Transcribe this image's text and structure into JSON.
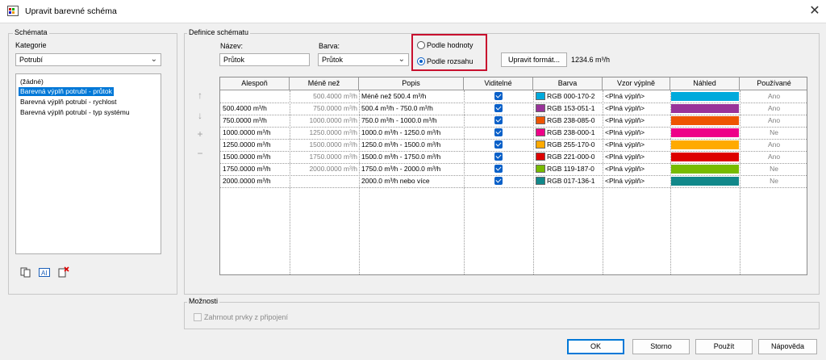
{
  "window": {
    "title": "Upravit barevné schéma",
    "close_glyph": "✕"
  },
  "schemes": {
    "legend": "Schémata",
    "category_label": "Kategorie",
    "category_value": "Potrubí",
    "list": [
      "(žádné)",
      "Barevná výplň potrubí - průtok",
      "Barevná výplň potrubí - rychlost",
      "Barevná výplň potrubí - typ systému"
    ],
    "selected_index": 1
  },
  "definition": {
    "legend": "Definice schématu",
    "name_label": "Název:",
    "name_value": "Průtok",
    "color_label": "Barva:",
    "color_value": "Průtok",
    "radio_by_value": "Podle hodnoty",
    "radio_by_range": "Podle rozsahu",
    "selected_radio": "range",
    "edit_format_button": "Upravit formát...",
    "format_sample": "1234.6 m³/h"
  },
  "table": {
    "columns": [
      "Alespoň",
      "Méně než",
      "Popis",
      "Viditelné",
      "Barva",
      "Vzor výplně",
      "Náhled",
      "Používané"
    ],
    "rows": [
      {
        "at_least": "",
        "less_than": "500.4000 m³/h",
        "caption": "Méně než 500.4 m³/h",
        "visible": true,
        "color_text": "RGB 000-170-2",
        "color": "#00aadc",
        "fill": "<Plná výplň>",
        "used": "Ano"
      },
      {
        "at_least": "500.4000 m³/h",
        "less_than": "750.0000 m³/h",
        "caption": "500.4 m³/h - 750.0 m³/h",
        "visible": true,
        "color_text": "RGB 153-051-1",
        "color": "#993399",
        "fill": "<Plná výplň>",
        "used": "Ano"
      },
      {
        "at_least": "750.0000 m³/h",
        "less_than": "1000.0000 m³/h",
        "caption": "750.0 m³/h - 1000.0 m³/h",
        "visible": true,
        "color_text": "RGB 238-085-0",
        "color": "#ee5500",
        "fill": "<Plná výplň>",
        "used": "Ano"
      },
      {
        "at_least": "1000.0000 m³/h",
        "less_than": "1250.0000 m³/h",
        "caption": "1000.0 m³/h - 1250.0 m³/h",
        "visible": true,
        "color_text": "RGB 238-000-1",
        "color": "#ee0088",
        "fill": "<Plná výplň>",
        "used": "Ne"
      },
      {
        "at_least": "1250.0000 m³/h",
        "less_than": "1500.0000 m³/h",
        "caption": "1250.0 m³/h - 1500.0 m³/h",
        "visible": true,
        "color_text": "RGB 255-170-0",
        "color": "#ffaa00",
        "fill": "<Plná výplň>",
        "used": "Ano"
      },
      {
        "at_least": "1500.0000 m³/h",
        "less_than": "1750.0000 m³/h",
        "caption": "1500.0 m³/h - 1750.0 m³/h",
        "visible": true,
        "color_text": "RGB 221-000-0",
        "color": "#dd0000",
        "fill": "<Plná výplň>",
        "used": "Ano"
      },
      {
        "at_least": "1750.0000 m³/h",
        "less_than": "2000.0000 m³/h",
        "caption": "1750.0 m³/h - 2000.0 m³/h",
        "visible": true,
        "color_text": "RGB 119-187-0",
        "color": "#77bb00",
        "fill": "<Plná výplň>",
        "used": "Ne"
      },
      {
        "at_least": "2000.0000 m³/h",
        "less_than": "",
        "caption": "2000.0 m³/h nebo více",
        "visible": true,
        "color_text": "RGB 017-136-1",
        "color": "#11888a",
        "fill": "<Plná výplň>",
        "used": "Ne"
      }
    ]
  },
  "options": {
    "legend": "Možnosti",
    "include_links_label": "Zahrnout prvky z připojení"
  },
  "buttons": {
    "ok": "OK",
    "cancel": "Storno",
    "apply": "Použít",
    "help": "Nápověda"
  },
  "icons": {
    "app": "color-scheme-app-icon",
    "duplicate": "duplicate-scheme-icon",
    "rename": "rename-scheme-icon",
    "delete": "delete-scheme-icon",
    "move_up": "move-row-up-icon",
    "move_down": "move-row-down-icon",
    "add_row": "add-row-icon",
    "remove_row": "remove-row-icon"
  }
}
